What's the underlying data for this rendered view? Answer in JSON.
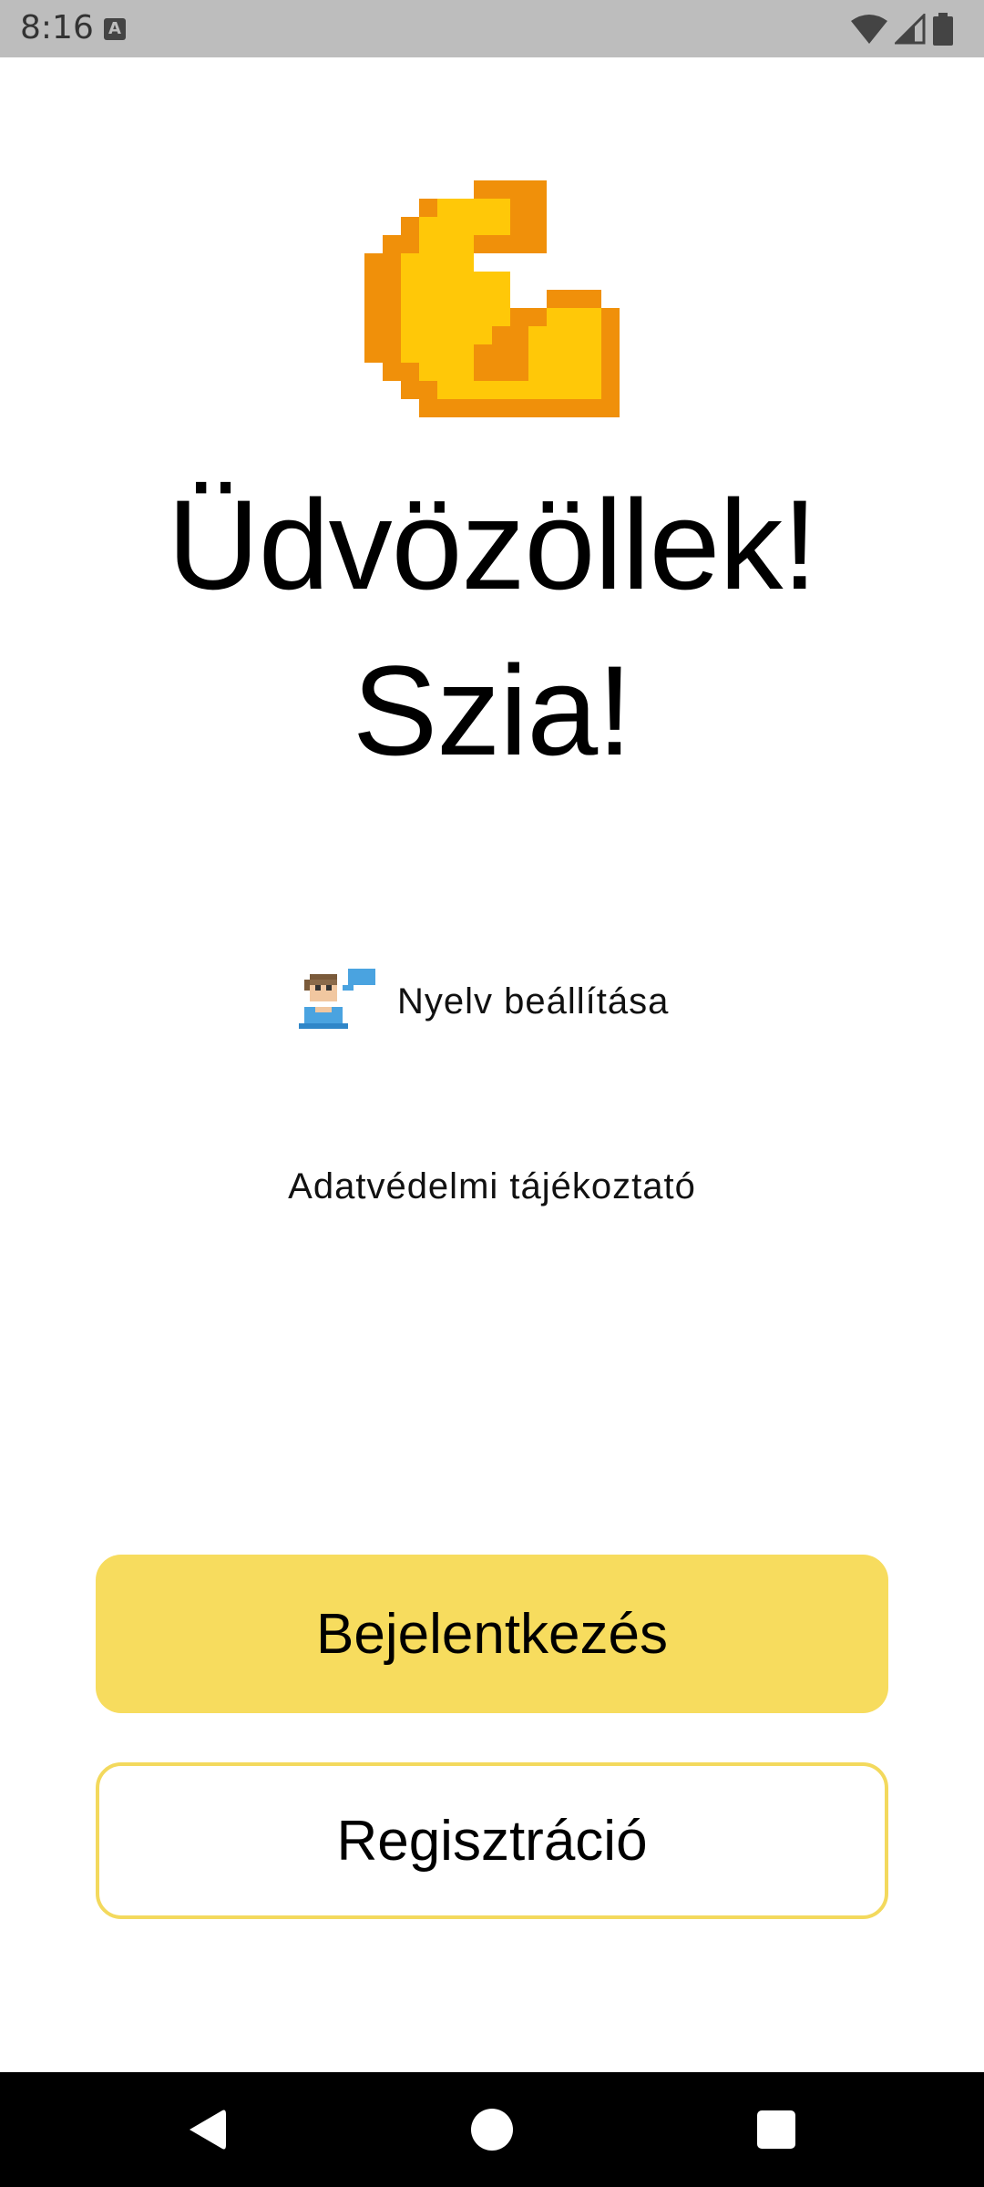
{
  "status_bar": {
    "time": "8:16",
    "notification_icon": "A"
  },
  "welcome": {
    "title": "Üdvözöllek!",
    "subtitle": "Szia!"
  },
  "language": {
    "icon": "person-speaking-icon",
    "label": "Nyelv beállítása"
  },
  "privacy": {
    "label": "Adatvédelmi tájékoztató"
  },
  "buttons": {
    "login": "Bejelentkezés",
    "register": "Regisztráció"
  },
  "colors": {
    "accent": "#f7dc5e",
    "accent_border": "#f3d95d",
    "logo_main": "#ffc808",
    "logo_shade": "#f0900a"
  },
  "nav": {
    "back": "back-icon",
    "home": "home-icon",
    "recents": "recents-icon"
  }
}
